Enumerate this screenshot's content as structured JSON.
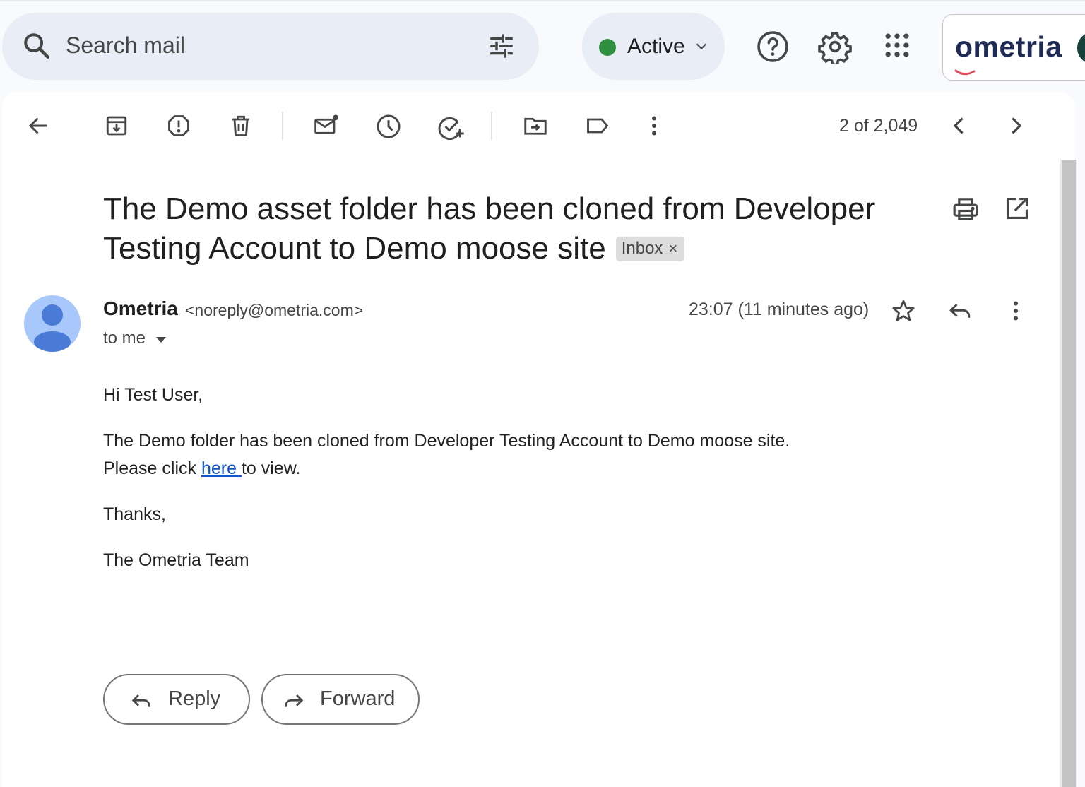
{
  "search": {
    "placeholder": "Search mail"
  },
  "status": {
    "label": "Active",
    "color": "#2e8f3e"
  },
  "brand": {
    "name": "ometria"
  },
  "toolbar": {
    "icons": [
      "back-arrow-icon",
      "archive-icon",
      "report-spam-icon",
      "delete-icon",
      "mark-unread-icon",
      "snooze-icon",
      "add-to-tasks-icon",
      "move-to-icon",
      "label-icon",
      "more-vert-icon"
    ],
    "pager_count": "2 of 2,049"
  },
  "email": {
    "subject": "The Demo asset folder has been cloned from Developer Testing Account to Demo moose site",
    "label_chip": "Inbox",
    "label_remove": "×",
    "sender_name": "Ometria",
    "sender_email": "<noreply@ometria.com>",
    "recipient": "to me",
    "timestamp": "23:07 (11 minutes ago)",
    "body": {
      "greeting": "Hi Test User,",
      "line1": "The Demo folder has been cloned from Developer Testing Account to Demo moose site.",
      "line2_before": "Please click ",
      "link_text": "here ",
      "line2_after": "to view.",
      "thanks": "Thanks,",
      "signature": "The Ometria Team"
    }
  },
  "actions": {
    "reply_label": "Reply",
    "forward_label": "Forward"
  },
  "colors": {
    "link": "#1155cc",
    "avatar_bg": "#a8c7fa",
    "avatar_fg": "#4a7bd6",
    "search_bg": "#e9eef6"
  }
}
